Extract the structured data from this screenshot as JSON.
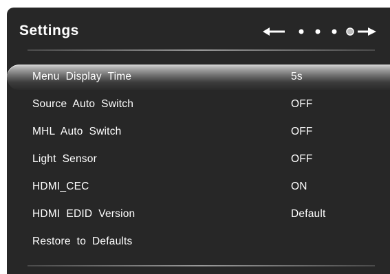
{
  "header": {
    "title": "Settings"
  },
  "nav": {
    "left_arrow_icon": "arrow-left-icon",
    "right_arrow_icon": "arrow-right-icon",
    "page_count": 4,
    "active_page": 4
  },
  "colors": {
    "panel_bg": "#272727",
    "text": "#ffffff"
  },
  "menu": {
    "items": [
      {
        "label": "Menu  Display  Time",
        "value": "5s"
      },
      {
        "label": "Source  Auto  Switch",
        "value": "OFF"
      },
      {
        "label": "MHL  Auto  Switch",
        "value": "OFF"
      },
      {
        "label": "Light  Sensor",
        "value": "OFF"
      },
      {
        "label": "HDMI_CEC",
        "value": "ON"
      },
      {
        "label": "HDMI  EDID  Version",
        "value": "Default"
      },
      {
        "label": "Restore  to  Defaults",
        "value": ""
      }
    ],
    "selected_index": 0
  }
}
